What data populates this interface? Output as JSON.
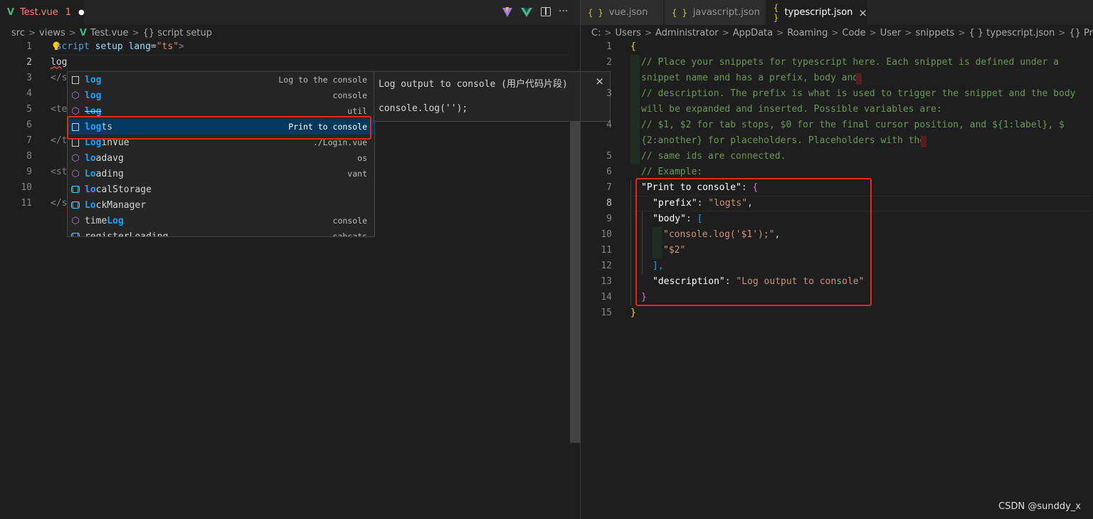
{
  "left": {
    "tab": {
      "label": "Test.vue",
      "errors": "1",
      "dirty_dot": "●"
    },
    "toolbar_icons": [
      "vite-icon",
      "vue-icon",
      "split-editor-icon",
      "more-actions-icon"
    ],
    "breadcrumb": [
      "src",
      "views",
      "Test.vue",
      "{} script setup"
    ],
    "lines": [
      {
        "n": "1"
      },
      {
        "n": "2"
      },
      {
        "n": "3"
      },
      {
        "n": "4"
      },
      {
        "n": "5"
      },
      {
        "n": "6"
      },
      {
        "n": "7"
      },
      {
        "n": "8"
      },
      {
        "n": "9"
      },
      {
        "n": "10"
      },
      {
        "n": "11"
      }
    ],
    "code": {
      "l1_tag": "<",
      "l1_name": "script",
      "l1_attr1": "setup",
      "l1_attr2": "lang",
      "l1_eq": "=",
      "l1_val": "\"ts\"",
      "l1_close": ">",
      "l2": "log",
      "l3": "</s",
      "l5": "<te",
      "l7": "</t",
      "l9": "<st",
      "l11": "</s"
    },
    "suggest": [
      {
        "icon": "snippet-icon",
        "pre": "log",
        "post": "",
        "detail": "Log to the console",
        "strike": false
      },
      {
        "icon": "module-icon",
        "pre": "log",
        "post": "",
        "detail": "console",
        "strike": false
      },
      {
        "icon": "module-icon",
        "pre": "log",
        "post": "",
        "detail": "util",
        "strike": true
      },
      {
        "icon": "snippet-icon",
        "pre": "log",
        "post": "ts",
        "detail": "Print to console",
        "strike": false
      },
      {
        "icon": "snippet-icon",
        "pre": "Log",
        "post": "inVue",
        "detail": "./Login.vue",
        "strike": false
      },
      {
        "icon": "module-icon",
        "pre": "lo",
        "post": "adavg",
        "detail": "os",
        "strike": false
      },
      {
        "icon": "module-icon",
        "pre": "Lo",
        "post": "ading",
        "detail": "vant",
        "strike": false
      },
      {
        "icon": "variable-icon",
        "pre": "lo",
        "post": "calStorage",
        "detail": "",
        "strike": false
      },
      {
        "icon": "variable-icon",
        "pre": "Lo",
        "post": "ckManager",
        "detail": "",
        "strike": false
      },
      {
        "icon": "module-icon",
        "pre": "time",
        "post": "Log",
        "detail": "console",
        "strike": false
      },
      {
        "icon": "variable-icon",
        "pre": "registerLo",
        "post": "ading",
        "detail": "sabcats",
        "strike": false
      }
    ],
    "doc": {
      "title": "Log output to console (用户代码片段)",
      "body": "console.log('');",
      "close": "×"
    }
  },
  "right": {
    "tabs": [
      {
        "label": "vue.json"
      },
      {
        "label": "javascript.json"
      },
      {
        "label": "typescript.json",
        "close": "×"
      }
    ],
    "breadcrumb": [
      "C:",
      "Users",
      "Administrator",
      "AppData",
      "Roaming",
      "Code",
      "User",
      "snippets",
      "{ } typescript.json",
      "{} Print to console"
    ],
    "line_numbers": [
      "1",
      "2",
      "",
      "3",
      "",
      "4",
      "",
      "5",
      "6",
      "7",
      "8",
      "9",
      "10",
      "11",
      "12",
      "13",
      "14",
      "15"
    ],
    "code": {
      "open_brace": "{",
      "c1": "// Place your snippets for typescript here. Each snippet is defined under a",
      "c1b": "snippet name and has a prefix, body and",
      "c2": "// description. The prefix is what is used to trigger the snippet and the body",
      "c2b": "will be expanded and inserted. Possible variables are:",
      "c3": "// $1, $2 for tab stops, $0 for the final cursor position, and ${1:label}, $",
      "c3b": "{2:another} for placeholders. Placeholders with the",
      "c4": "// same ids are connected.",
      "c5": "// Example:",
      "k_print": "\"Print to console\"",
      "k_prefix": "\"prefix\"",
      "v_prefix": "\"logts\"",
      "k_body": "\"body\"",
      "v_body1": "\"console.log('$1');\"",
      "v_body2": "\"$2\"",
      "k_desc": "\"description\"",
      "v_desc": "\"Log output to console\"",
      "close_inner": "}",
      "close_outer": "}",
      "colon": ": ",
      "comma": ",",
      "lbracket": "[",
      "rbracket": "],"
    }
  },
  "watermark": "CSDN @sunddy_x",
  "colors": {
    "accent_red": "#e8261c",
    "selection": "#04395e",
    "comment": "#6a9955",
    "string": "#ce9178"
  }
}
